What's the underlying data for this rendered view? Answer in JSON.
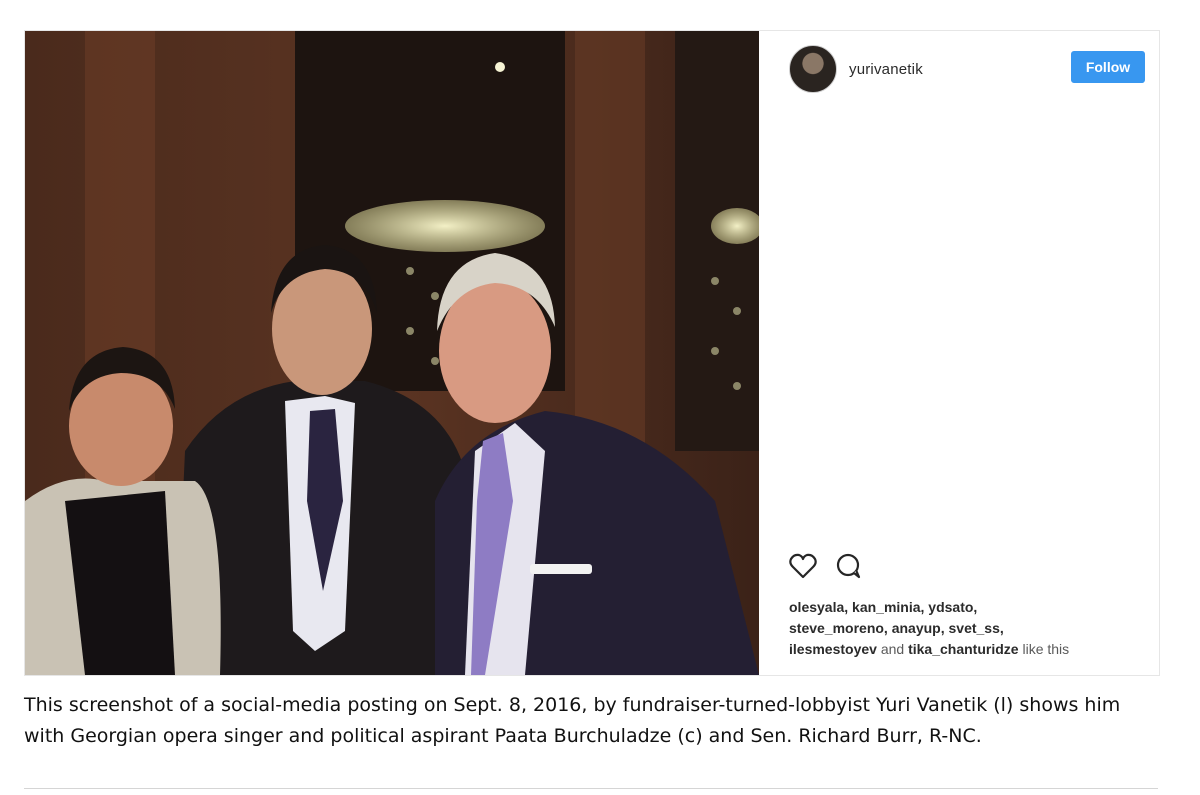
{
  "post": {
    "username": "yurivanetik",
    "follow_label": "Follow",
    "likes": {
      "users_line1": "olesyala, kan_minia, ydsato,",
      "users_line2": "steve_moreno, anayup, svet_ss,",
      "user_a": "ilesmestoyev",
      "and_text": "and",
      "user_b": "tika_chanturidze",
      "like_suffix": "like this"
    },
    "icons": {
      "like": "heart-icon",
      "comment": "comment-icon"
    }
  },
  "caption": {
    "text": "This screenshot of a social-media posting on Sept. 8, 2016, by fundraiser-turned-lobbyist Yuri Vanetik (l) shows him with Georgian opera singer and political aspirant Paata Burchuladze (c) and Sen. Richard Burr, R-NC."
  },
  "colors": {
    "follow_button": "#3897f0",
    "photo_background": "#3a2217"
  }
}
